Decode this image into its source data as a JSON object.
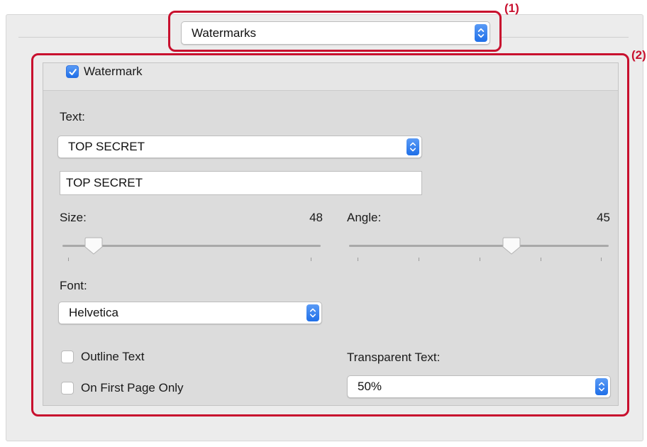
{
  "callouts": {
    "c1": "(1)",
    "c2": "(2)"
  },
  "pane_menu": {
    "value": "Watermarks"
  },
  "watermark": {
    "enable_label": "Watermark",
    "enabled": true,
    "text_label": "Text:",
    "text_preset": "TOP SECRET",
    "text_value": "TOP SECRET",
    "size_label": "Size:",
    "size_value": "48",
    "size_level": 0.12,
    "angle_label": "Angle:",
    "angle_value": "45",
    "angle_level": 0.625,
    "font_label": "Font:",
    "font_value": "Helvetica",
    "outline_label": "Outline Text",
    "outline_checked": false,
    "first_page_label": "On First Page Only",
    "first_page_checked": false,
    "transparent_label": "Transparent Text:",
    "transparent_value": "50%"
  },
  "icons": {
    "stepper": "up-down-chevron-icon",
    "check": "checkmark-icon",
    "thumb": "slider-thumb-icon"
  },
  "colors": {
    "callout": "#c8102e",
    "accent": "#1f6fe8"
  }
}
